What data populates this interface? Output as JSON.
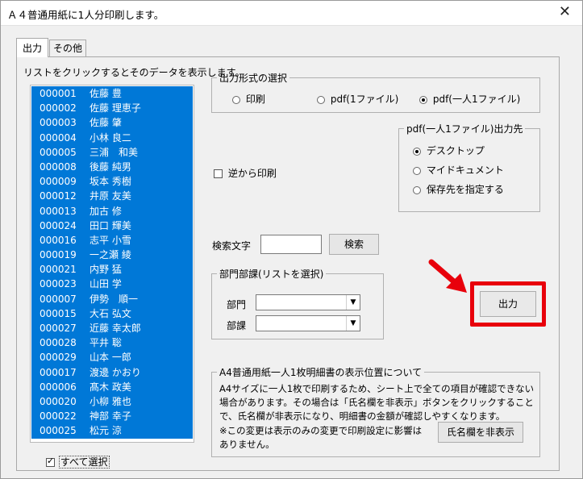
{
  "window": {
    "title": "Ａ４普通用紙に1人分印刷します。",
    "close_glyph": "✕"
  },
  "tabs": [
    {
      "label": "出力"
    },
    {
      "label": "その他"
    }
  ],
  "list": {
    "caption": "リストをクリックするとそのデータを表示します。",
    "items": [
      {
        "code": "000001",
        "name": "佐藤 豊"
      },
      {
        "code": "000002",
        "name": "佐藤 理恵子"
      },
      {
        "code": "000003",
        "name": "佐藤 肇"
      },
      {
        "code": "000004",
        "name": "小林 良二"
      },
      {
        "code": "000005",
        "name": "三浦　和美"
      },
      {
        "code": "000008",
        "name": "後藤 純男"
      },
      {
        "code": "000009",
        "name": "坂本 秀樹"
      },
      {
        "code": "000012",
        "name": "井原 友美"
      },
      {
        "code": "000013",
        "name": "加古 修"
      },
      {
        "code": "000024",
        "name": "田口 輝美"
      },
      {
        "code": "000016",
        "name": "志平 小雪"
      },
      {
        "code": "000019",
        "name": "一之瀬 綾"
      },
      {
        "code": "000021",
        "name": "内野 猛"
      },
      {
        "code": "000023",
        "name": "山田 学"
      },
      {
        "code": "000007",
        "name": "伊勢　順一"
      },
      {
        "code": "000015",
        "name": "大石 弘文"
      },
      {
        "code": "000027",
        "name": "近藤 幸太郎"
      },
      {
        "code": "000028",
        "name": "平井 聡"
      },
      {
        "code": "000029",
        "name": "山本 一郎"
      },
      {
        "code": "000017",
        "name": "渡邊 かおり"
      },
      {
        "code": "000006",
        "name": "髙木 政美"
      },
      {
        "code": "000020",
        "name": "小柳 雅也"
      },
      {
        "code": "000022",
        "name": "神部 幸子"
      },
      {
        "code": "000025",
        "name": "松元 涼"
      }
    ],
    "select_all_label": "すべて選択",
    "select_all_checked": true
  },
  "output_format": {
    "legend": "出力形式の選択",
    "options": [
      {
        "label": "印刷"
      },
      {
        "label": "pdf(1ファイル)"
      },
      {
        "label": "pdf(一人1ファイル)"
      }
    ],
    "selected": "pdf(一人1ファイル)"
  },
  "pdf_dest": {
    "legend": "pdf(一人1ファイル)出力先",
    "options": [
      {
        "label": "デスクトップ"
      },
      {
        "label": "マイドキュメント"
      },
      {
        "label": "保存先を指定する"
      }
    ],
    "selected": "デスクトップ"
  },
  "reverse_print": {
    "label": "逆から印刷",
    "checked": false
  },
  "search": {
    "label": "検索文字",
    "value": "",
    "button": "検索"
  },
  "dept": {
    "legend": "部門部課(リストを選択)",
    "dept_label": "部門",
    "section_label": "部課",
    "dept_value": "",
    "section_value": ""
  },
  "output_button": {
    "label": "出力",
    "highlight_color": "#e8000b"
  },
  "display_pos": {
    "legend": "A4普通用紙一人1枚明細書の表示位置について",
    "text1": "A4サイズに一人1枚で印刷するため、シート上で全ての項目が確認できない場合があります。その場合は「氏名欄を非表示」ボタンをクリックすることで、氏名欄が非表示になり、明細書の金額が確認しやすくなります。",
    "text2": "※この変更は表示のみの変更で印刷設定に影響はありません。",
    "button": "氏名欄を非表示"
  },
  "colors": {
    "list_selection": "#0078d7",
    "arrow": "#e8000b"
  }
}
